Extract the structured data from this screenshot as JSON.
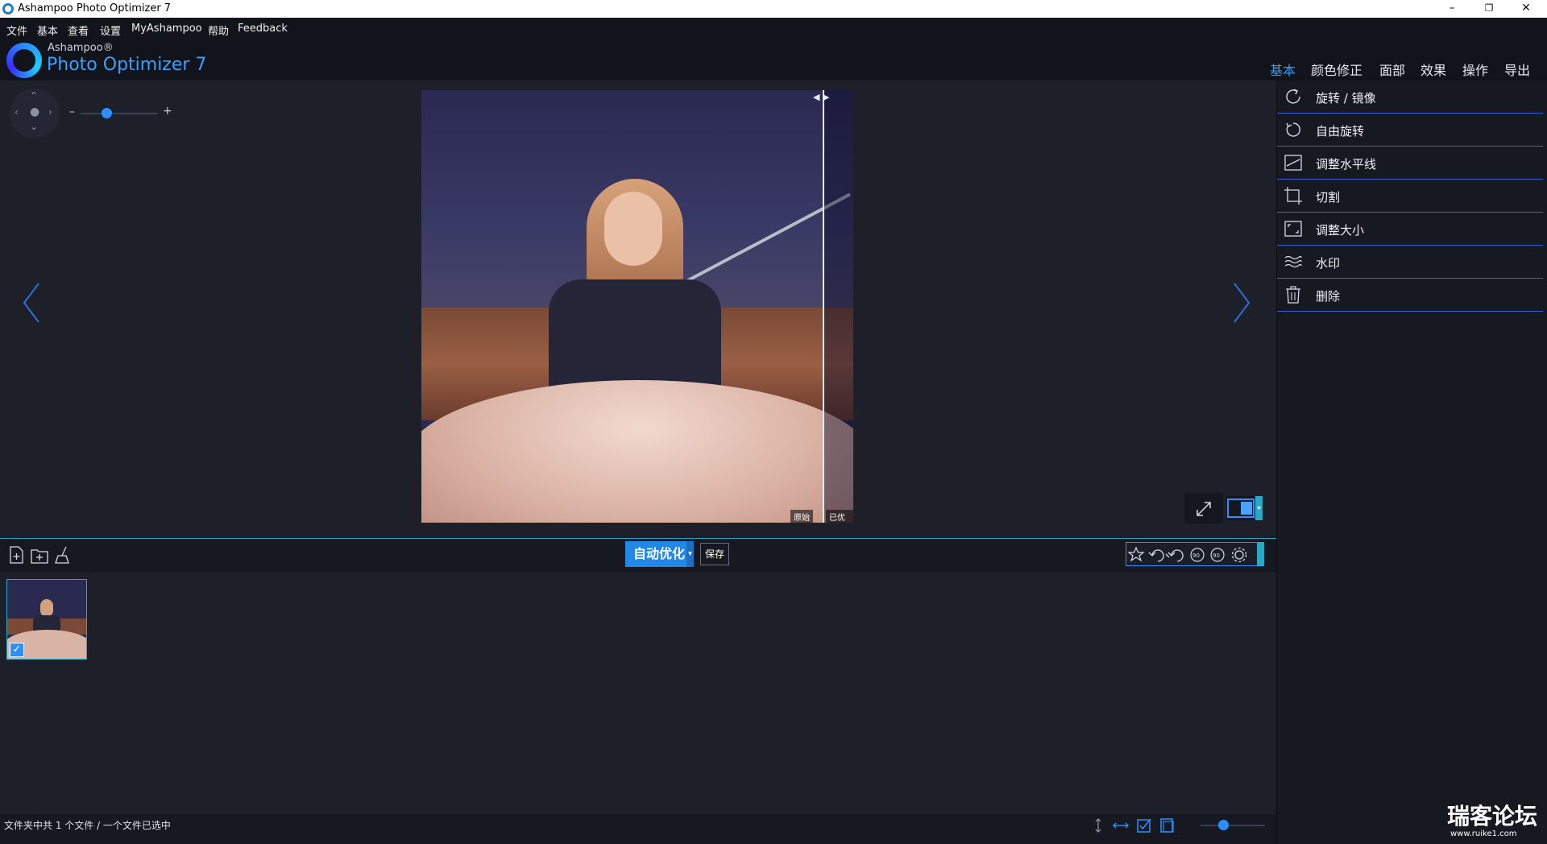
{
  "window": {
    "title": "Ashampoo Photo Optimizer 7",
    "minimize": "–",
    "restore": "❐",
    "close": "✕"
  },
  "menu": [
    "文件",
    "基本",
    "查看",
    "设置",
    "MyAshampoo",
    "帮助",
    "Feedback"
  ],
  "brand": {
    "small": "Ashampoo®",
    "big": "Photo Optimizer 7"
  },
  "tabs": [
    "基本",
    "颜色修正",
    "面部",
    "效果",
    "操作",
    "导出"
  ],
  "viewer": {
    "zoom_minus": "–",
    "zoom_plus": "+",
    "zoom_level": 0.35,
    "label_original": "原始",
    "label_optimized": "已优化",
    "split_arrows": "◀ ▶"
  },
  "toolbar": {
    "auto_optimize": "自动优化",
    "save": "保存"
  },
  "status": {
    "text": "文件夹中共 1 个文件 / 一个文件已选中"
  },
  "right_panel": [
    {
      "label": "旋转 / 镜像",
      "icon": "rotate-mirror-icon"
    },
    {
      "label": "自由旋转",
      "icon": "free-rotate-icon"
    },
    {
      "label": "调整水平线",
      "icon": "horizon-icon"
    },
    {
      "label": "切割",
      "icon": "crop-icon"
    },
    {
      "label": "调整大小",
      "icon": "resize-icon"
    },
    {
      "label": "水印",
      "icon": "watermark-icon"
    },
    {
      "label": "删除",
      "icon": "trash-icon"
    }
  ],
  "watermark": {
    "text": "瑞客论坛",
    "sub": "www.ruike1.com"
  },
  "colors": {
    "accent": "#2d9cff",
    "background": "#1e2029",
    "panel": "#171920",
    "divider": "#3b5fd8",
    "teal": "#2aa9c4"
  }
}
